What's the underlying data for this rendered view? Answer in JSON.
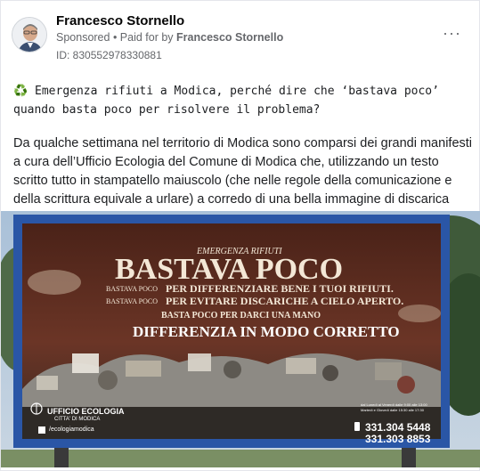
{
  "post": {
    "author": "Francesco Stornello",
    "sponsored": "Sponsored",
    "separator": " • ",
    "paid_for_prefix": "Paid for by ",
    "paid_for_name": "Francesco Stornello",
    "ad_id": "ID: 830552978330881",
    "more_icon": "···",
    "headline_icon": "♻️",
    "headline_line1": " Emergenza rifiuti a Modica, perché dire che ‘bastava poco’",
    "headline_line2": "quando basta poco per risolvere il problema?",
    "body": "Da qualche settimana nel territorio di Modica sono comparsi dei grandi manifesti a cura dell’Ufficio Ecologia del Comune di Modica che, utilizzando un testo scritto tutto in stampatello maiuscolo (che nelle regole della comunicazione e della scrittura equivale a urlare) a corredo di una bella immagine di discarica abusiva,…"
  },
  "billboard": {
    "kicker": "EMERGENZA RIFIUTI",
    "title": "BASTAVA POCO",
    "line1_left": "BASTAVA POCO",
    "line1_right": "PER DIFFERENZIARE BENE I TUOI RIFIUTI.",
    "line2_left": "BASTAVA POCO",
    "line2_right": "PER EVITARE DISCARICHE A CIELO APERTO.",
    "line3": "BASTA POCO PER DARCI UNA MANO",
    "line4": "DIFFERENZIA IN MODO CORRETTO",
    "office": "UFFICIO ECOLOGIA",
    "city": "CITTA' DI MODICA",
    "social": "/ecologiamodica",
    "hours1": "dal Lunedì al Venerdì dalle 9:00 alle 13:00",
    "hours2": "Martedì e Giovedì dalle 15:30 alle 17:30",
    "phone1": "331.304 5448",
    "phone2": "331.303 8853"
  },
  "colors": {
    "billboard_frame": "#2a56a6",
    "billboard_bg": "#5a2a1e",
    "sky": "#9bb5cf",
    "meta_text": "#65676b"
  }
}
